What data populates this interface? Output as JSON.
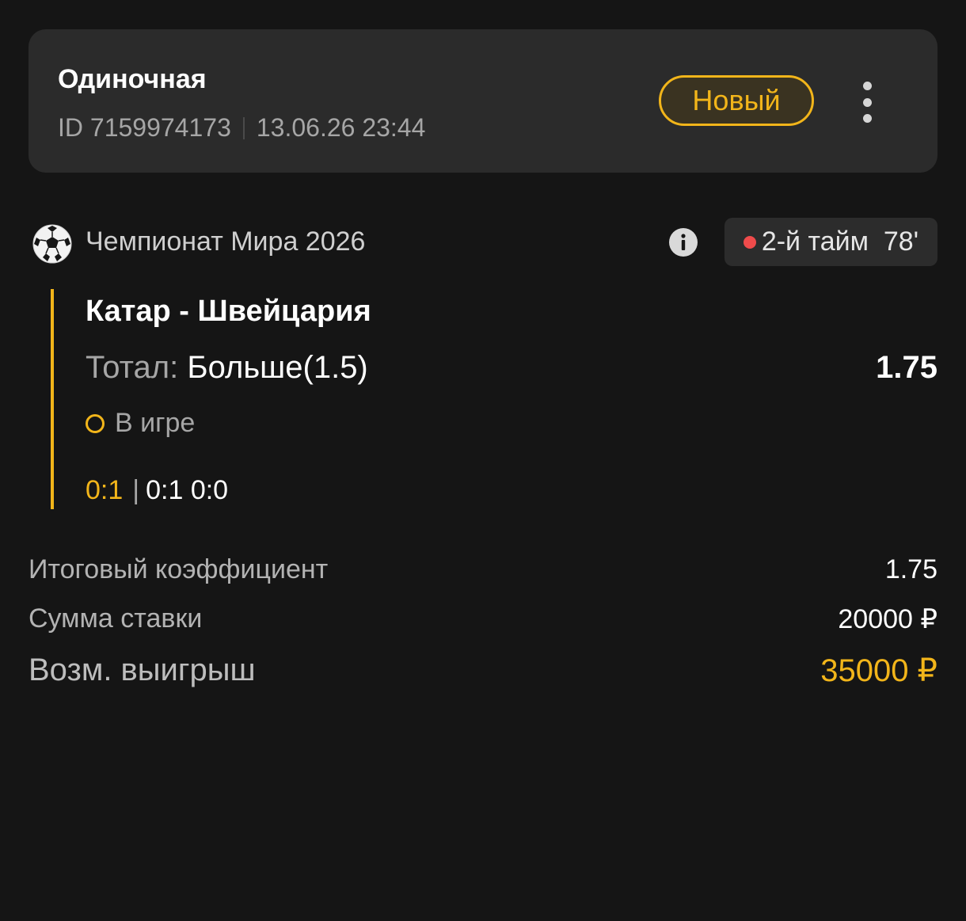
{
  "header": {
    "bet_type": "Одиночная",
    "bet_id": "ID 7159974173",
    "datetime": "13.06.26 23:44",
    "status_badge": "Новый",
    "accent_color": "#f2b51a"
  },
  "league": {
    "icon": "soccer-ball-icon",
    "name": "Чемпионат Мира 2026",
    "info_icon": "info-icon",
    "live_status": "2-й тайм  78'",
    "live_dot_color": "#ef4b4b"
  },
  "event": {
    "match": "Катар - Швейцария",
    "market_label": "Тотал:",
    "market_value": "Больше(1.5)",
    "odds": "1.75",
    "state": "В игре",
    "score_main": "0:1",
    "score_periods": "0:1 0:0"
  },
  "summary": {
    "total_odds_label": "Итоговый коэффициент",
    "total_odds_value": "1.75",
    "stake_label": "Сумма ставки",
    "stake_value": "20000 ₽",
    "payout_label": "Возм. выигрыш",
    "payout_value": "35000 ₽"
  }
}
